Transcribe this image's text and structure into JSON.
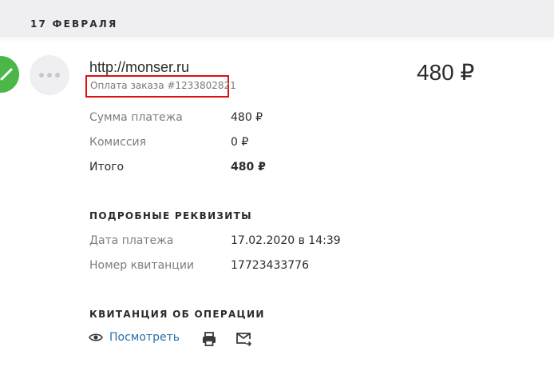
{
  "date_header": "17 ФЕВРАЛЯ",
  "payment": {
    "merchant": "http://monser.ru",
    "order": "Оплата заказа #1233802821",
    "amount": "480 ₽",
    "status_icon": "check-icon",
    "avatar_icon": "more-dots-icon"
  },
  "summary": {
    "rows": [
      {
        "label": "Сумма платежа",
        "value": "480 ₽"
      },
      {
        "label": "Комиссия",
        "value": "0 ₽"
      },
      {
        "label": "Итого",
        "value": "480 ₽"
      }
    ]
  },
  "details": {
    "title": "ПОДРОБНЫЕ РЕКВИЗИТЫ",
    "rows": [
      {
        "label": "Дата платежа",
        "value": "17.02.2020 в 14:39"
      },
      {
        "label": "Номер квитанции",
        "value": "17723433776"
      }
    ]
  },
  "receipt": {
    "title": "КВИТАНЦИЯ ОБ ОПЕРАЦИИ",
    "view_label": "Посмотреть",
    "icons": [
      "eye-icon",
      "print-icon",
      "email-send-icon"
    ]
  },
  "colors": {
    "success": "#4cb749",
    "link": "#2a6ea8",
    "highlight_border": "#e01010",
    "topbar_bg": "#efeff1"
  }
}
